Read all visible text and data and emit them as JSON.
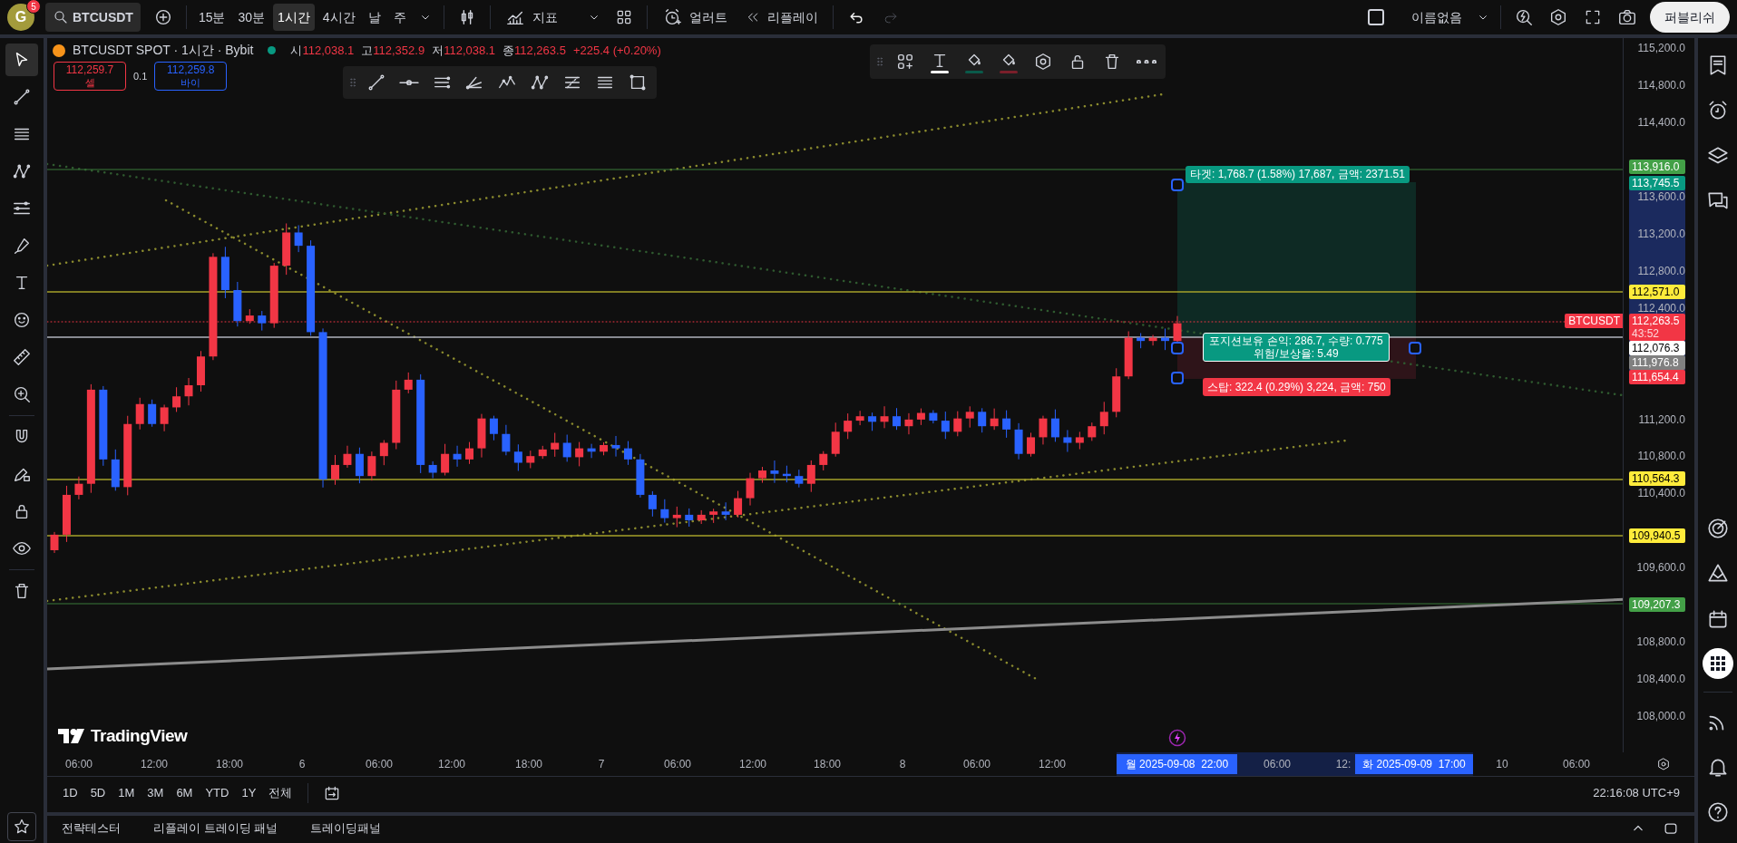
{
  "top_bar": {
    "avatar": {
      "letter": "G",
      "badge": "5"
    },
    "symbol": "BTCUSDT",
    "intervals": [
      {
        "label": "15분",
        "selected": false
      },
      {
        "label": "30분",
        "selected": false
      },
      {
        "label": "1시간",
        "selected": true
      },
      {
        "label": "4시간",
        "selected": false
      },
      {
        "label": "날",
        "selected": false
      },
      {
        "label": "주",
        "selected": false
      }
    ],
    "indicators_label": "지표",
    "alert_label": "얼러트",
    "replay_label": "리플레이",
    "history": [
      {
        "kind": "undo",
        "disabled": false
      },
      {
        "kind": "redo",
        "disabled": true
      }
    ],
    "layout_checked": false,
    "layout_name": "이름없음",
    "publish_label": "퍼블리쉬"
  },
  "legend": {
    "title": "BTCUSDT SPOT · 1시간 · Bybit",
    "ohlc": [
      {
        "label": "시",
        "value": "112,038.1"
      },
      {
        "label": "고",
        "value": "112,352.9"
      },
      {
        "label": "저",
        "value": "112,038.1"
      },
      {
        "label": "종",
        "value": "112,263.5"
      }
    ],
    "change": "+225.4 (+0.20%)",
    "sell": {
      "price": "112,259.7",
      "label": "셀"
    },
    "spread": "0.1",
    "buy": {
      "price": "112,259.8",
      "label": "바이"
    }
  },
  "left_tools": [
    {
      "kind": "cursor",
      "selected": true
    },
    {
      "kind": "trendline",
      "selected": false
    },
    {
      "kind": "lines",
      "selected": false
    },
    {
      "kind": "pattern",
      "selected": false
    },
    {
      "kind": "fib",
      "selected": false
    },
    {
      "kind": "brush",
      "selected": false
    },
    {
      "kind": "text",
      "selected": false
    },
    {
      "kind": "emoji",
      "selected": false
    },
    {
      "kind": "ruler",
      "selected": false
    },
    {
      "kind": "zoom",
      "selected": false
    },
    {
      "kind": "magnet",
      "selected": false
    },
    {
      "kind": "draw-lock",
      "selected": false
    },
    {
      "kind": "lock",
      "selected": false
    },
    {
      "kind": "eye",
      "selected": false
    },
    {
      "kind": "trash",
      "selected": false
    }
  ],
  "position_tool": {
    "target_label": "타겟: 1,768.7 (1.58%) 17,687, 금액: 2371.51",
    "info_lines": [
      "포지션보유 손익: 286.7, 수량: 0.775",
      "위험/보상율: 5.49"
    ],
    "stop_label": "스탑: 322.4 (0.29%) 3,224, 금액: 750"
  },
  "logo_text": "TradingView",
  "price_axis": {
    "ticks": [
      "115,200.0",
      "114,800.0",
      "114,400.0",
      "113,600.0",
      "113,200.0",
      "112,800.0",
      "112,400.0",
      "111,200.0",
      "110,800.0",
      "110,400.0",
      "109,600.0",
      "108,800.0",
      "108,400.0",
      "108,000.0"
    ],
    "markers": [
      {
        "text": "113,916.0",
        "color": "#43a047"
      },
      {
        "text": "113,745.5",
        "color": "#089981"
      },
      {
        "text": "112,571.0",
        "color": "#ffeb3b"
      },
      {
        "text": "112,263.5",
        "color": "#f23645",
        "countdown": "43:52"
      },
      {
        "text": "112,076.3",
        "color": "#ffffff"
      },
      {
        "text": "111,976.8",
        "color": "#808080"
      },
      {
        "text": "111,654.4",
        "color": "#f23645"
      },
      {
        "text": "110,564.3",
        "color": "#ffeb3b"
      },
      {
        "text": "109,940.5",
        "color": "#ffeb3b"
      },
      {
        "text": "109,207.3",
        "color": "#43a047"
      }
    ],
    "symbol_tag": "BTCUSDT"
  },
  "time_axis": {
    "ticks": [
      "06:00",
      "12:00",
      "18:00",
      "6",
      "06:00",
      "12:00",
      "18:00",
      "7",
      "06:00",
      "12:00",
      "18:00",
      "8",
      "06:00",
      "12:00",
      "06:00",
      "12:",
      "10",
      "06:00"
    ],
    "highlights": [
      "월 2025-09-08  22:00",
      "화 2025-09-09  17:00"
    ]
  },
  "range_bar": {
    "ranges": [
      "1D",
      "5D",
      "1M",
      "3M",
      "6M",
      "YTD",
      "1Y",
      "전체"
    ],
    "clock": "22:16:08 UTC+9"
  },
  "bottom_panel": {
    "tabs": [
      "전략테스터",
      "리플레이 트레이딩 패널",
      "트레이딩패널"
    ]
  }
}
